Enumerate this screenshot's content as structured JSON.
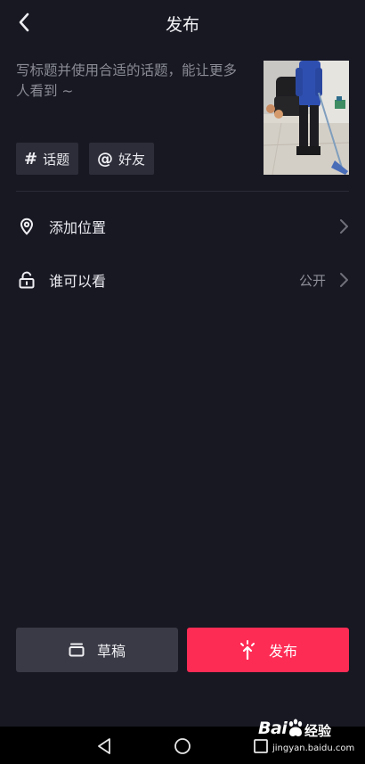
{
  "header": {
    "title": "发布"
  },
  "caption": {
    "placeholder": "写标题并使用合适的话题，能让更多人看到 ~",
    "value": ""
  },
  "chips": [
    {
      "icon": "#",
      "label": "话题"
    },
    {
      "icon": "@",
      "label": "好友"
    }
  ],
  "rows": {
    "location": {
      "label": "添加位置",
      "value": ""
    },
    "visibility": {
      "label": "谁可以看",
      "value": "公开"
    }
  },
  "buttons": {
    "draft": "草稿",
    "publish": "发布"
  },
  "watermark": {
    "logo": "Bai",
    "text": "经验",
    "url": "jingyan.baidu.com"
  },
  "colors": {
    "background": "#171822",
    "publish": "#fd2c55",
    "draft": "#393a45",
    "caret": "#f7c325"
  }
}
